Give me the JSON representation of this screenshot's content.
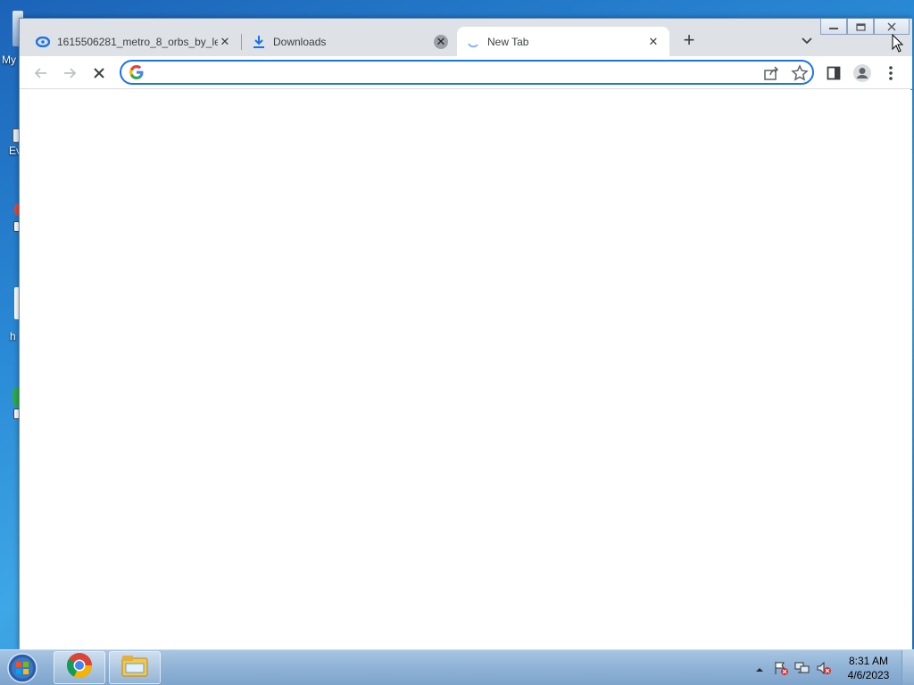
{
  "desktop": {
    "icon_labels": [
      "My",
      "Ev",
      "h",
      ""
    ]
  },
  "browser": {
    "tabs": [
      {
        "title": "1615506281_metro_8_orbs_by_le",
        "icon": "edge-like-icon",
        "active": false
      },
      {
        "title": "Downloads",
        "icon": "download-icon",
        "active": false
      },
      {
        "title": "New Tab",
        "icon": "loading-spinner-icon",
        "active": true
      }
    ],
    "new_tab_label": "+",
    "omnibox": {
      "value": "",
      "placeholder": ""
    },
    "accent": "#1a73e8"
  },
  "taskbar": {
    "clock_time": "8:31 AM",
    "clock_date": "4/6/2023",
    "apps": [
      "chrome-icon",
      "file-explorer-icon"
    ]
  }
}
